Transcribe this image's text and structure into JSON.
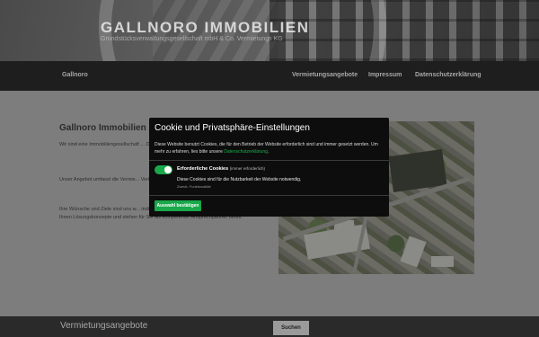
{
  "header": {
    "title": "GALLNORO IMMOBILIEN",
    "subtitle": "Grundstücksverwaltungsgesellschaft mbH & Co. Vermietungs KG"
  },
  "nav": {
    "brand": "Gallnoro",
    "links": [
      "Vermietungsangebote",
      "Impressum",
      "Datenschutzerklärung"
    ]
  },
  "main": {
    "heading": "Gallnoro Immobilien",
    "paragraphs": [
      "Wir sind eine Immobiliengesellschaft ... Deutschlands im Bereich der Gew... besitzt.",
      "Unser Angebot umfasst die Vermie... Verkaufsflächen sowie Stellplätze...",
      "Ihre Wünsche und Ziele sind uns w... individuelle Mietflächen mit maximalem Nutzen, entwickeln mit Ihnen Lösungskonzepte und stehen für Sie als kompetenter Ansprechpartner bereit."
    ]
  },
  "cookie_modal": {
    "title": "Cookie und Privatsphäre-Einstellungen",
    "description": "Diese Website benutzt Cookies, die für den Betrieb der Website erforderlich sind und immer gesetzt werden. Um mehr zu erfahren, lies bitte unsere",
    "privacy_link": "Datenschutzerklärung",
    "option": {
      "label": "Erforderliche Cookies",
      "note": "(immer erforderlich)",
      "description": "Diese Cookies sind für die Nutzbarkeit der Website notwendig.",
      "meta": "Zweck: Funktionalität",
      "enabled": true
    },
    "save_button": "Auswahl bestätigen"
  },
  "footer_bar": {
    "label": "Vermietungsangebote",
    "search_button": "Suchen"
  },
  "colors": {
    "accent": "#19a84a",
    "nav_bg": "#1e1e1e",
    "modal_bg": "#0d0d0d"
  }
}
